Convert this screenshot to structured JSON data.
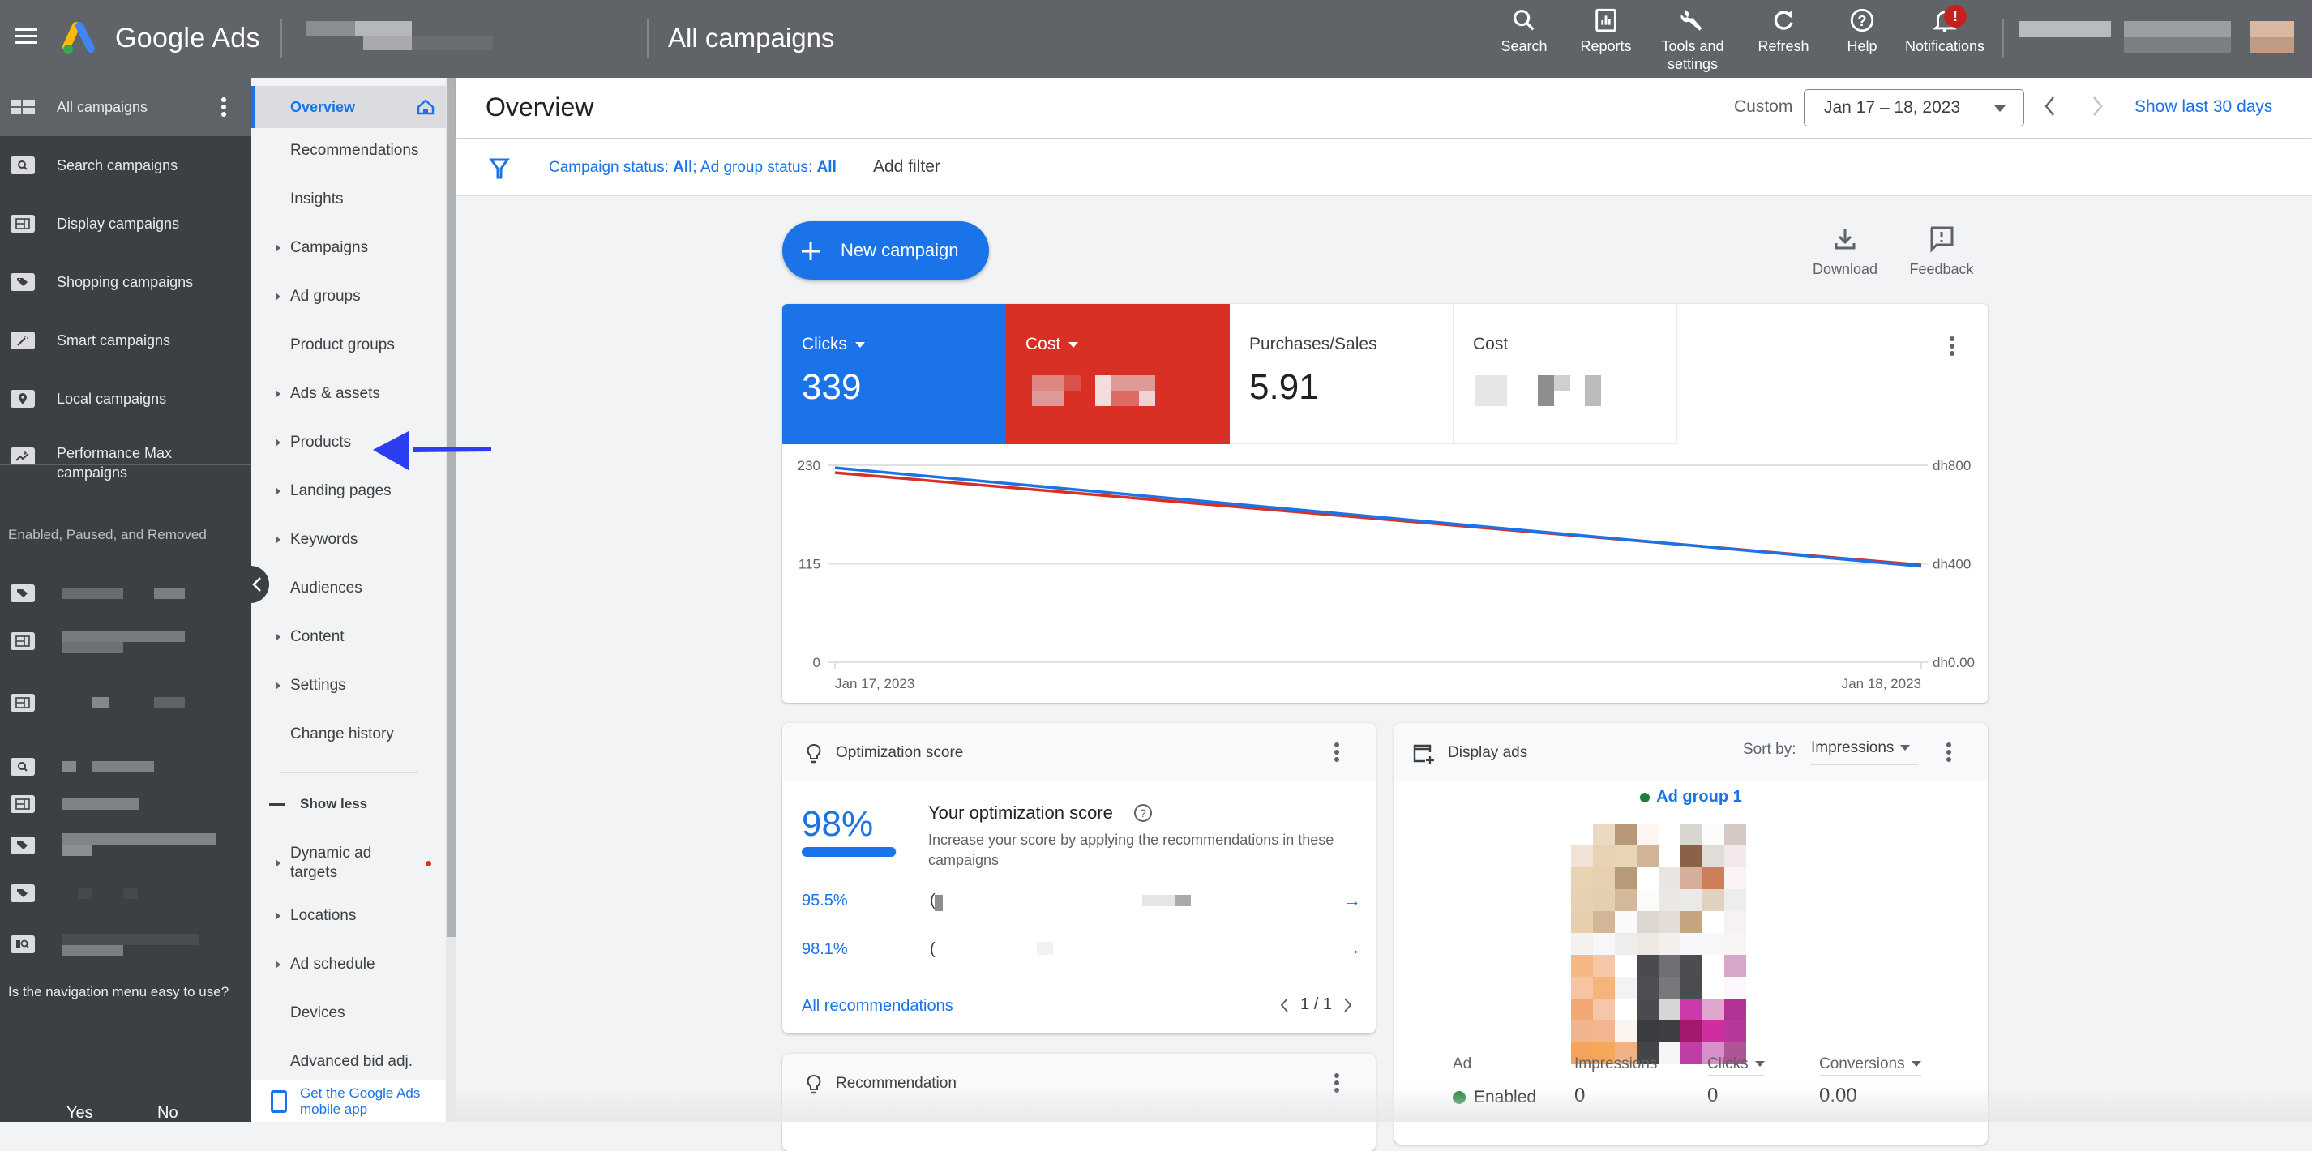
{
  "topbar": {
    "brand": "Google Ads",
    "page_title": "All campaigns",
    "actions": [
      {
        "id": "search",
        "label": "Search",
        "icon": "search-icon"
      },
      {
        "id": "reports",
        "label": "Reports",
        "icon": "reports-icon"
      },
      {
        "id": "tools",
        "label": "Tools and settings",
        "icon": "wrench-icon"
      },
      {
        "id": "refresh",
        "label": "Refresh",
        "icon": "refresh-icon"
      },
      {
        "id": "help",
        "label": "Help",
        "icon": "help-icon"
      },
      {
        "id": "notifications",
        "label": "Notifications",
        "icon": "bell-icon",
        "badge": "!"
      }
    ]
  },
  "leftnav": {
    "items": [
      {
        "label": "All campaigns",
        "icon": "all-campaigns-icon",
        "active": true
      },
      {
        "label": "Search campaigns",
        "icon": "search-campaign-icon"
      },
      {
        "label": "Display campaigns",
        "icon": "display-campaign-icon"
      },
      {
        "label": "Shopping campaigns",
        "icon": "shopping-tag-icon"
      },
      {
        "label": "Smart campaigns",
        "icon": "magic-wand-icon"
      },
      {
        "label": "Local campaigns",
        "icon": "location-pin-icon"
      },
      {
        "label": "Performance Max campaigns",
        "icon": "performance-max-icon"
      }
    ],
    "section_label": "Enabled, Paused, and Removed",
    "feedback_question": "Is the navigation menu easy to use?",
    "feedback_yes": "Yes",
    "feedback_no": "No"
  },
  "subnav": {
    "items": [
      {
        "label": "Overview",
        "active": true,
        "expandable": false
      },
      {
        "label": "Recommendations",
        "expandable": false
      },
      {
        "label": "Insights",
        "expandable": false
      },
      {
        "label": "Campaigns",
        "expandable": true
      },
      {
        "label": "Ad groups",
        "expandable": true
      },
      {
        "label": "Product groups",
        "expandable": false
      },
      {
        "label": "Ads & assets",
        "expandable": true
      },
      {
        "label": "Products",
        "expandable": true
      },
      {
        "label": "Landing pages",
        "expandable": true
      },
      {
        "label": "Keywords",
        "expandable": true
      },
      {
        "label": "Audiences",
        "expandable": false
      },
      {
        "label": "Content",
        "expandable": true
      },
      {
        "label": "Settings",
        "expandable": true
      },
      {
        "label": "Change history",
        "expandable": false
      }
    ],
    "show_less": "Show less",
    "extra_items": [
      {
        "label": "Dynamic ad targets",
        "expandable": true,
        "alert": true
      },
      {
        "label": "Locations",
        "expandable": true
      },
      {
        "label": "Ad schedule",
        "expandable": true
      },
      {
        "label": "Devices",
        "expandable": false
      },
      {
        "label": "Advanced bid adj.",
        "expandable": false
      }
    ],
    "mobile_app": "Get the Google Ads mobile app"
  },
  "overview": {
    "title": "Overview",
    "date_mode": "Custom",
    "date_range": "Jan 17 – 18, 2023",
    "show_last_30": "Show last 30 days",
    "filter_prefix1": "Campaign status: ",
    "filter_val1": "All",
    "filter_prefix2": "; Ad group status: ",
    "filter_val2": "All",
    "add_filter": "Add filter",
    "new_campaign": "New campaign",
    "download": "Download",
    "feedback": "Feedback"
  },
  "metrics": [
    {
      "label": "Clicks",
      "value": "339",
      "color": "#1a73e8",
      "selected": true
    },
    {
      "label": "Cost",
      "value": "",
      "color": "#d93025",
      "selected": true,
      "redacted": true
    },
    {
      "label": "Purchases/Sales",
      "value": "5.91",
      "selected": false
    },
    {
      "label": "Cost",
      "value": "",
      "selected": false,
      "redacted": true
    }
  ],
  "chart_data": {
    "type": "line",
    "title": "",
    "x": [
      "Jan 17, 2023",
      "Jan 18, 2023"
    ],
    "series": [
      {
        "name": "Clicks",
        "axis": "left",
        "color": "#1a73e8",
        "values": [
          227,
          112
        ]
      },
      {
        "name": "Cost",
        "axis": "right",
        "color": "#d93025",
        "values": [
          770,
          395
        ]
      }
    ],
    "y_left": {
      "ticks": [
        "0",
        "115",
        "230"
      ],
      "range": [
        0,
        230
      ]
    },
    "y_right": {
      "ticks": [
        "dh0.00",
        "dh400",
        "dh800"
      ],
      "range": [
        0,
        800
      ]
    },
    "grid": true,
    "legend": "none"
  },
  "optimization": {
    "title": "Optimization score",
    "score": "98%",
    "score_fraction": 0.98,
    "heading": "Your optimization score",
    "description": "Increase your score by applying the recommendations in these campaigns",
    "rows": [
      {
        "pct": "95.5%",
        "name": "("
      },
      {
        "pct": "98.1%",
        "name": "("
      }
    ],
    "all_recommendations": "All recommendations",
    "pager": "1 / 1"
  },
  "recommendation_card": {
    "title": "Recommendation"
  },
  "display_ads": {
    "title": "Display ads",
    "sort_label": "Sort by:",
    "sort_value": "Impressions",
    "ad_group": "Ad group 1",
    "columns": [
      "Ad",
      "Impressions",
      "Clicks",
      "Conversions"
    ],
    "row": {
      "status": "Enabled",
      "impressions": "0",
      "clicks": "0",
      "conversions": "0.00"
    }
  }
}
